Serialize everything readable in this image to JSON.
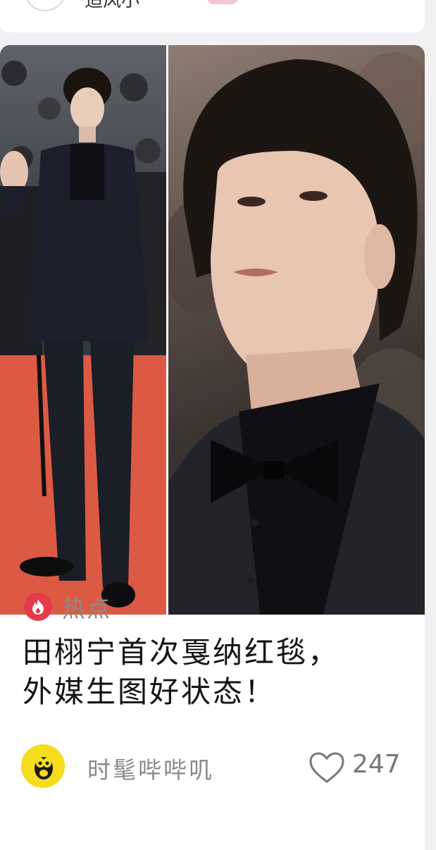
{
  "previous_card": {
    "author_name": "追风小",
    "icons": [
      "avatar",
      "emoji-badge",
      "chevron-down-icon"
    ]
  },
  "card": {
    "photos": [
      "red-carpet-full-body-photo",
      "close-up-portrait-photo"
    ],
    "tag": {
      "icon": "flame-icon",
      "label": "热点",
      "color": "#e63a4c"
    },
    "headline": {
      "line1": "田栩宁首次戛纳红毯，",
      "line2": "外媒生图好状态！"
    },
    "author": {
      "name": "时髦哔哔叽",
      "avatar_color": "#f6dc1f"
    },
    "likes": {
      "icon": "heart-outline-icon",
      "count": "247"
    }
  }
}
